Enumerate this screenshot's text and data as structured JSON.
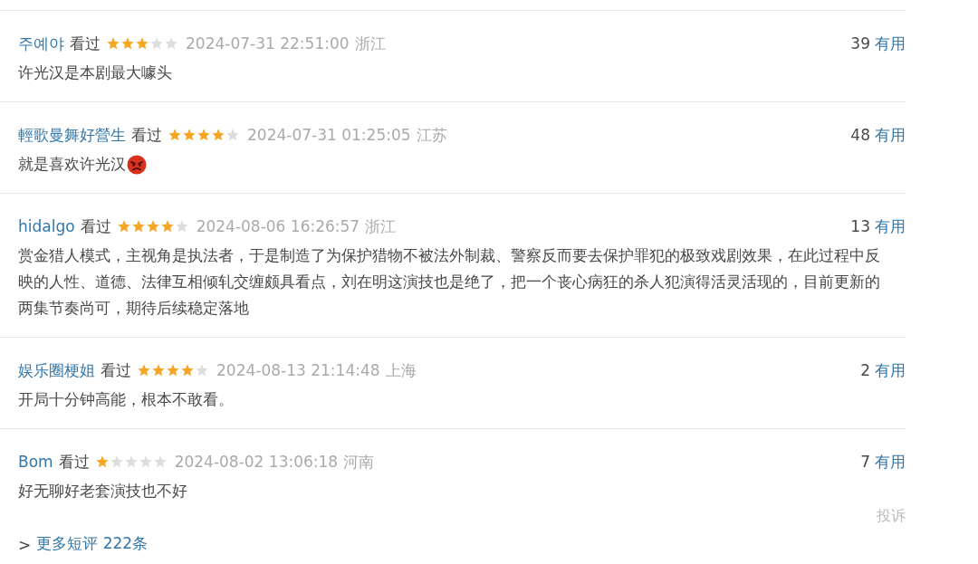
{
  "comments": [
    {
      "user": "주예야",
      "status": "看过",
      "stars": 3,
      "time": "2024-07-31 22:51:00",
      "location": "浙江",
      "votes": "39",
      "vote_label": "有用",
      "text": "许光汉是本剧最大噱头",
      "emoji": false
    },
    {
      "user": "輕歌曼舞好營生",
      "status": "看过",
      "stars": 4,
      "time": "2024-07-31 01:25:05",
      "location": "江苏",
      "votes": "48",
      "vote_label": "有用",
      "text": "就是喜欢许光汉",
      "emoji": true
    },
    {
      "user": "hidalgo",
      "status": "看过",
      "stars": 4,
      "time": "2024-08-06 16:26:57",
      "location": "浙江",
      "votes": "13",
      "vote_label": "有用",
      "text": "赏金猎人模式，主视角是执法者，于是制造了为保护猎物不被法外制裁、警察反而要去保护罪犯的极致戏剧效果，在此过程中反映的人性、道德、法律互相倾轧交缠颇具看点，刘在明这演技也是绝了，把一个丧心病狂的杀人犯演得活灵活现的，目前更新的两集节奏尚可，期待后续稳定落地",
      "emoji": false
    },
    {
      "user": "娱乐圈梗姐",
      "status": "看过",
      "stars": 4,
      "time": "2024-08-13 21:14:48",
      "location": "上海",
      "votes": "2",
      "vote_label": "有用",
      "text": "开局十分钟高能，根本不敢看。",
      "emoji": false
    },
    {
      "user": "Bom",
      "status": "看过",
      "stars": 1,
      "time": "2024-08-02 13:06:18",
      "location": "河南",
      "votes": "7",
      "vote_label": "有用",
      "text": "好无聊好老套演技也不好",
      "emoji": false
    }
  ],
  "footer": {
    "prefix": ">",
    "more_link": "更多短评 222条",
    "report_link": "投诉"
  }
}
